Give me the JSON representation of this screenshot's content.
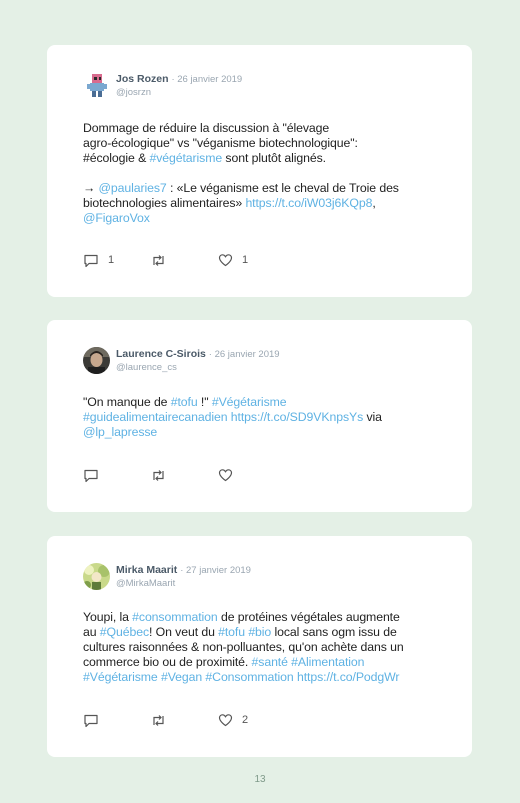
{
  "tweets": [
    {
      "name": "Jos Rozen",
      "date": "· 26 janvier 2019",
      "handle": "@josrzn",
      "p1_a": "Dommage de réduire la discussion à \"élevage",
      "p1_b": "agro-écologique\" vs \"véganisme biotechnologique\":",
      "p1_c_pre": "#écologie & ",
      "p1_c_link": "#végétarisme",
      "p1_c_post": " sont plutôt alignés.",
      "p2_a_pre": "→ ",
      "p2_a_link": "@paularies7",
      "p2_a_post": " : «Le véganisme est le cheval de Troie des",
      "p2_b_pre": "biotechnologies alimentaires» ",
      "p2_b_link": "https://t.co/iW03j6KQp8",
      "p2_b_post": ",",
      "p2_c_link": "@FigaroVox",
      "replies": "1",
      "likes": "1"
    },
    {
      "name": "Laurence C-Sirois",
      "date": "· 26 janvier 2019",
      "handle": "@laurence_cs",
      "l1_pre": "\"On manque de ",
      "l1_link": "#tofu",
      "l1_mid": " !\" ",
      "l1_link2": "#Végétarisme",
      "l2_link": "#guidealimentairecanadien https://t.co/SD9VKnpsYs",
      "l2_post": " via",
      "l3_link": "@lp_lapresse"
    },
    {
      "name": "Mirka Maarit",
      "date": "· 27 janvier 2019",
      "handle": "@MirkaMaarit",
      "l1_pre": "Youpi, la ",
      "l1_link": "#consommation",
      "l1_post": " de protéines végétales augmente",
      "l2_pre": "au ",
      "l2_link": "#Québec",
      "l2_mid": "! On veut du ",
      "l2_link2": "#tofu",
      "l2_sp": " ",
      "l2_link3": "#bio",
      "l2_post": " local sans ogm issu de",
      "l3": "cultures raisonnées & non-polluantes, qu'on achète dans un",
      "l4_pre": "commerce bio ou de proximité. ",
      "l4_link": "#santé #Alimentation",
      "l5_link": "#Végétarisme #Vegan #Consommation https://t.co/PodgWr",
      "likes": "2"
    }
  ],
  "page_number": "13"
}
